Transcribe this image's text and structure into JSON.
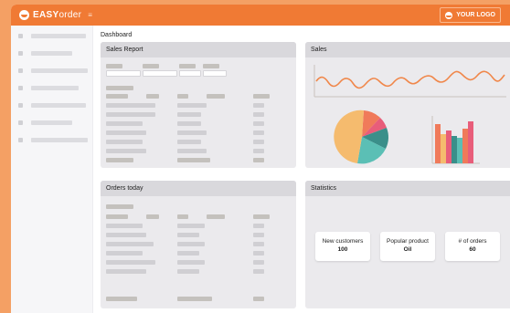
{
  "brand": {
    "name_bold": "EASY",
    "name_light": "order",
    "menu_icon": "hamburger-icon"
  },
  "header": {
    "your_logo": "YOUR LOGO"
  },
  "page": {
    "title": "Dashboard"
  },
  "sales_report": {
    "title": "Sales Report"
  },
  "sales": {
    "title": "Sales"
  },
  "orders_today": {
    "title": "Orders today"
  },
  "statistics": {
    "title": "Statistics",
    "cards": [
      {
        "label": "New customers",
        "value": "100"
      },
      {
        "label": "Popular product",
        "value": "Oil"
      },
      {
        "label": "# of orders",
        "value": "60"
      }
    ]
  },
  "colors": {
    "topbar": "#f07a34",
    "frame": "#f4a064",
    "line": "#f0874a",
    "pie": [
      "#f5bb6e",
      "#5bbfb5",
      "#3a8f8a",
      "#e85d7a",
      "#f07a5a"
    ],
    "bars": [
      "#f5bb6e",
      "#e85d7a",
      "#3a8f8a",
      "#5bbfb5",
      "#f07a5a"
    ]
  }
}
